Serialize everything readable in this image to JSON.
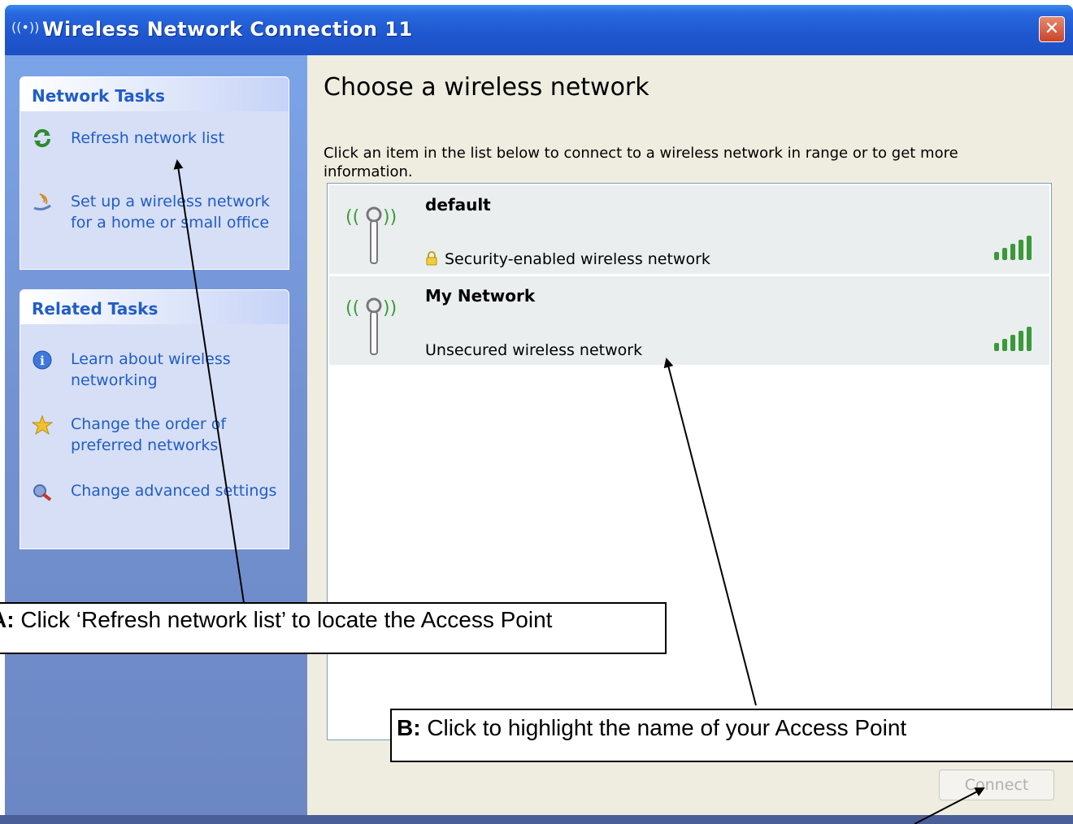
{
  "window": {
    "title": "Wireless Network Connection 11",
    "close_label": "✕"
  },
  "sidebar": {
    "network_tasks": {
      "header": "Network Tasks",
      "items": [
        {
          "label": "Refresh network list",
          "icon": "refresh-icon"
        },
        {
          "label": "Set up a wireless network for a home or small office",
          "icon": "wireless-setup-icon"
        }
      ]
    },
    "related_tasks": {
      "header": "Related Tasks",
      "items": [
        {
          "label": "Learn about wireless networking",
          "icon": "info-icon"
        },
        {
          "label": "Change the order of preferred networks",
          "icon": "star-icon"
        },
        {
          "label": "Change advanced settings",
          "icon": "settings-icon"
        }
      ]
    }
  },
  "main": {
    "title": "Choose a wireless network",
    "description": "Click an item in the list below to connect to a wireless network in range or to get more information.",
    "networks": [
      {
        "name": "default",
        "security": "Security-enabled wireless network",
        "secured": true,
        "signal_bars": 5
      },
      {
        "name": "My Network",
        "security": "Unsecured wireless network",
        "secured": false,
        "signal_bars": 5
      }
    ],
    "connect_label": "Connect"
  },
  "callouts": {
    "a_prefix": "A:",
    "a_text": " Click ‘Refresh network list’ to locate the  Access Point",
    "b_prefix": "B:",
    "b_text": " Click to highlight the name of your Access Point"
  },
  "colors": {
    "title_bar": "#2767dd",
    "sidebar": "#7492d2",
    "task_link": "#215dc6",
    "main_bg": "#efede0"
  }
}
